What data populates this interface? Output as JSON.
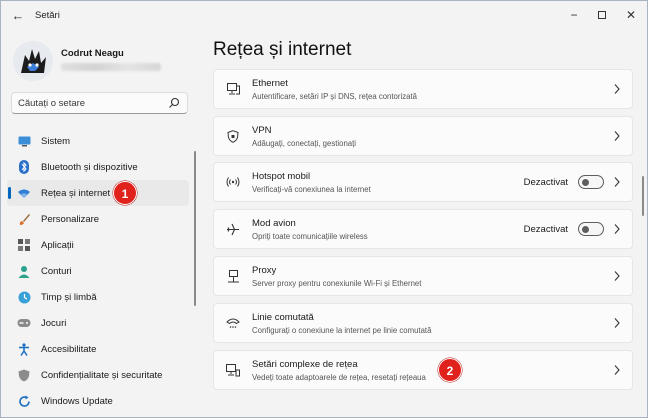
{
  "window": {
    "title": "Setări",
    "back_glyph": "←",
    "minimize_glyph": "−",
    "close_glyph": "✕"
  },
  "profile": {
    "name": "Codrut Neagu"
  },
  "search": {
    "placeholder": "Căutați o setare"
  },
  "sidebar": {
    "items": [
      {
        "label": "Sistem",
        "icon": "monitor-icon"
      },
      {
        "label": "Bluetooth și dispozitive",
        "icon": "bluetooth-icon"
      },
      {
        "label": "Rețea și internet",
        "icon": "wifi-icon",
        "active": true
      },
      {
        "label": "Personalizare",
        "icon": "brush-icon"
      },
      {
        "label": "Aplicații",
        "icon": "apps-icon"
      },
      {
        "label": "Conturi",
        "icon": "person-icon"
      },
      {
        "label": "Timp și limbă",
        "icon": "globe-clock-icon"
      },
      {
        "label": "Jocuri",
        "icon": "gamepad-icon"
      },
      {
        "label": "Accesibilitate",
        "icon": "accessibility-icon"
      },
      {
        "label": "Confidențialitate și securitate",
        "icon": "shield-icon"
      },
      {
        "label": "Windows Update",
        "icon": "update-icon"
      }
    ]
  },
  "main": {
    "title": "Rețea și internet",
    "cards": [
      {
        "title": "Ethernet",
        "subtitle": "Autentificare, setări IP și DNS, rețea contorizată",
        "icon": "ethernet-icon"
      },
      {
        "title": "VPN",
        "subtitle": "Adăugați, conectați, gestionați",
        "icon": "vpn-shield-icon"
      },
      {
        "title": "Hotspot mobil",
        "subtitle": "Verificați-vă conexiunea la internet",
        "icon": "hotspot-icon",
        "toggle": "Dezactivat",
        "toggle_on": false
      },
      {
        "title": "Mod avion",
        "subtitle": "Opriți toate comunicațiile wireless",
        "icon": "airplane-icon",
        "toggle": "Dezactivat",
        "toggle_on": false
      },
      {
        "title": "Proxy",
        "subtitle": "Server proxy pentru conexiunile Wi-Fi și Ethernet",
        "icon": "proxy-icon"
      },
      {
        "title": "Linie comutată",
        "subtitle": "Configurați o conexiune la internet pe linie comutată",
        "icon": "dialup-icon"
      },
      {
        "title": "Setări complexe de rețea",
        "subtitle": "Vedeți toate adaptoarele de rețea, resetați rețeaua",
        "icon": "network-adapter-icon"
      }
    ]
  },
  "annotations": {
    "badge_1": "1",
    "badge_2": "2"
  },
  "colors": {
    "accent": "#0067c0",
    "badge": "#e0211c",
    "window_bg": "#f3f3f3",
    "card_bg": "#fbfbfb"
  }
}
